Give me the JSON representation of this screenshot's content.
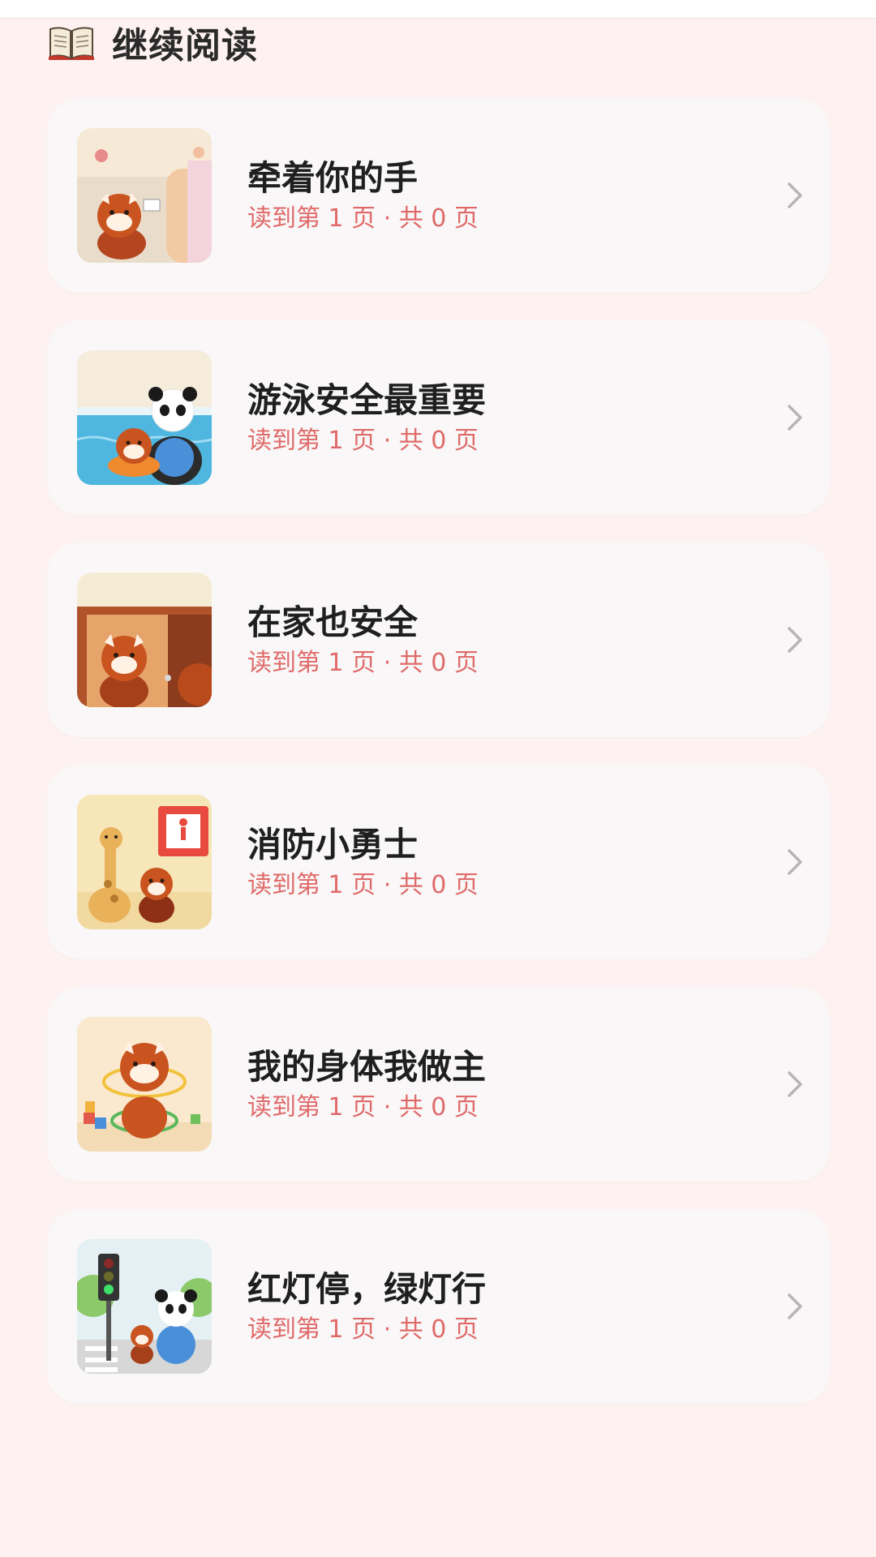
{
  "section": {
    "title": "继续阅读",
    "icon": "open-book-icon"
  },
  "books": [
    {
      "title": "牵着你的手",
      "progress": "读到第 1 页 · 共 0 页"
    },
    {
      "title": "游泳安全最重要",
      "progress": "读到第 1 页 · 共 0 页"
    },
    {
      "title": "在家也安全",
      "progress": "读到第 1 页 · 共 0 页"
    },
    {
      "title": "消防小勇士",
      "progress": "读到第 1 页 · 共 0 页"
    },
    {
      "title": "我的身体我做主",
      "progress": "读到第 1 页 · 共 0 页"
    },
    {
      "title": "红灯停，绿灯行",
      "progress": "读到第 1 页 · 共 0 页"
    }
  ],
  "colors": {
    "page_background": "#fdf2f1",
    "card_background": "#f9f7f7",
    "progress_text": "#e06a6a",
    "title_text": "#1f1f1f"
  }
}
